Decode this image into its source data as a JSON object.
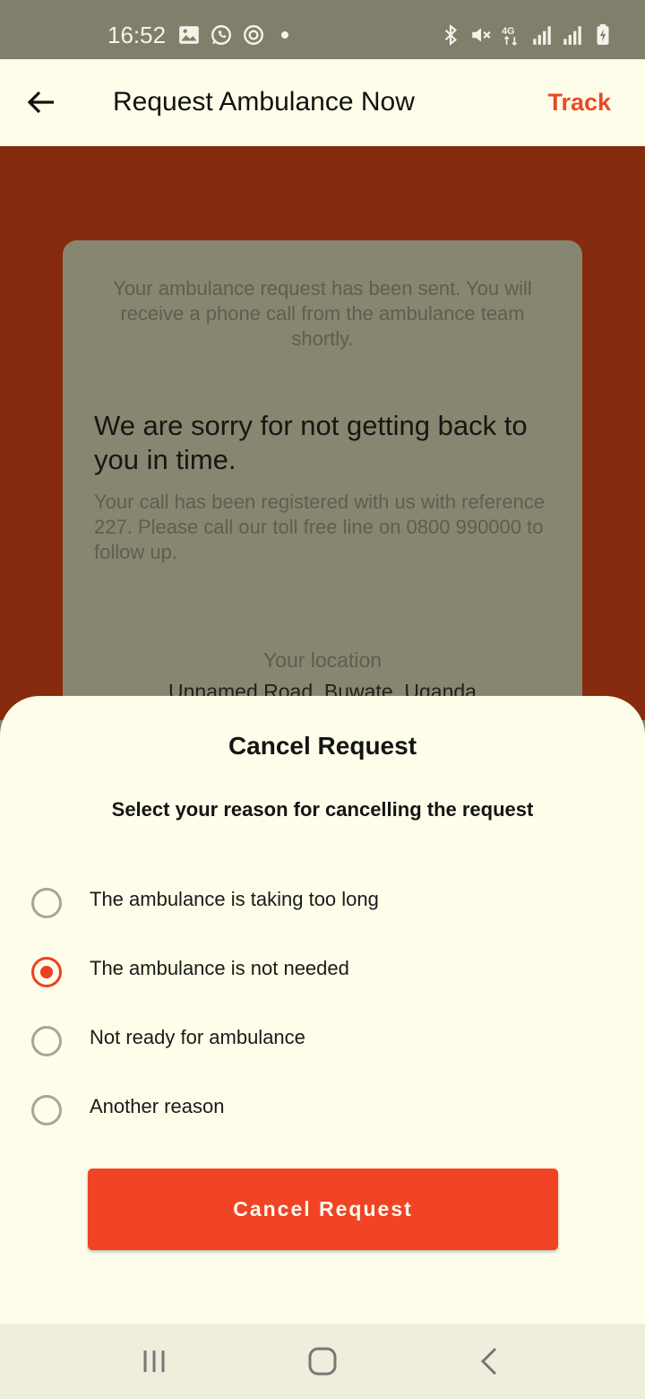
{
  "status_bar": {
    "time": "16:52",
    "left_icons": [
      "gallery-icon",
      "whatsapp-icon",
      "sync-icon",
      "dot-icon"
    ],
    "right_icons": [
      "bluetooth-icon",
      "mute-icon",
      "4g-icon",
      "signal-icon",
      "signal-icon",
      "battery-charging-icon"
    ]
  },
  "app_bar": {
    "title": "Request Ambulance Now",
    "track_label": "Track",
    "back_icon": "back-arrow-icon"
  },
  "info_card": {
    "sent_message": "Your ambulance request has been sent. You will receive a phone call from the ambulance team shortly.",
    "sorry_heading": "We are sorry for not getting back to you in time.",
    "reference_message": "Your call has been registered with us with reference 227. Please call our toll free line on 0800 990000 to follow up.",
    "location_label": "Your location",
    "location_value": "Unnamed Road, Buwate, Uganda"
  },
  "sheet": {
    "title": "Cancel Request",
    "subtitle": "Select your reason for cancelling the request",
    "options": [
      {
        "label": "The ambulance is taking too long",
        "selected": false
      },
      {
        "label": "The ambulance is not needed",
        "selected": true
      },
      {
        "label": "Not ready for ambulance",
        "selected": false
      },
      {
        "label": "Another reason",
        "selected": false
      }
    ],
    "button_label": "Cancel Request"
  },
  "colors": {
    "accent": "#f04424",
    "background_scrim": "#862b0d",
    "sheet_bg": "#fefde9"
  },
  "nav_bar": {
    "icons": [
      "recents-icon",
      "home-icon",
      "back-icon"
    ]
  }
}
